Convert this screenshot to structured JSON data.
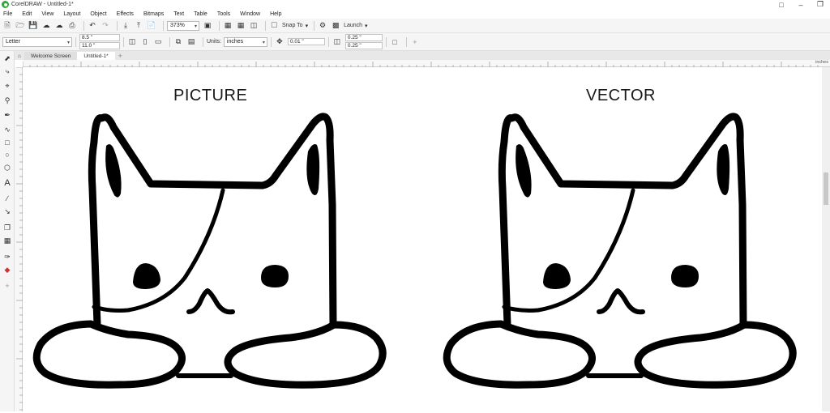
{
  "window": {
    "title": "CorelDRAW - Untitled-1*"
  },
  "menu": [
    "File",
    "Edit",
    "View",
    "Layout",
    "Object",
    "Effects",
    "Bitmaps",
    "Text",
    "Table",
    "Tools",
    "Window",
    "Help"
  ],
  "toolbar": {
    "zoom": "373%",
    "snap_label": "Snap To",
    "launch_label": "Launch"
  },
  "propbar": {
    "page_size": "Letter",
    "width": "8.5 \"",
    "height": "11.0 \"",
    "units_label": "Units:",
    "units_value": "inches",
    "nudge": "0.01 \"",
    "dup_x": "0.25 \"",
    "dup_y": "0.25 \""
  },
  "tabs": {
    "welcome": "Welcome Screen",
    "untitled": "Untitled-1*",
    "add": "+"
  },
  "ruler": {
    "unit_label": "inches"
  },
  "artwork": {
    "left_title": "PICTURE",
    "right_title": "VECTOR"
  },
  "icons": [
    "app-logo",
    "new-icon",
    "open-icon",
    "save-icon",
    "import-icon",
    "export-icon",
    "undo-icon",
    "redo-icon",
    "zoom-fit-icon",
    "gear-icon",
    "pick-tool-icon",
    "shape-tool-icon",
    "crop-icon",
    "zoom-icon",
    "freehand-icon",
    "artistic-media-icon",
    "rectangle-icon",
    "ellipse-icon",
    "polygon-icon",
    "text-icon",
    "dimension-icon",
    "connector-icon",
    "shadow-icon",
    "transparency-icon",
    "eyedropper-icon",
    "fill-icon",
    "add-tool-icon"
  ]
}
